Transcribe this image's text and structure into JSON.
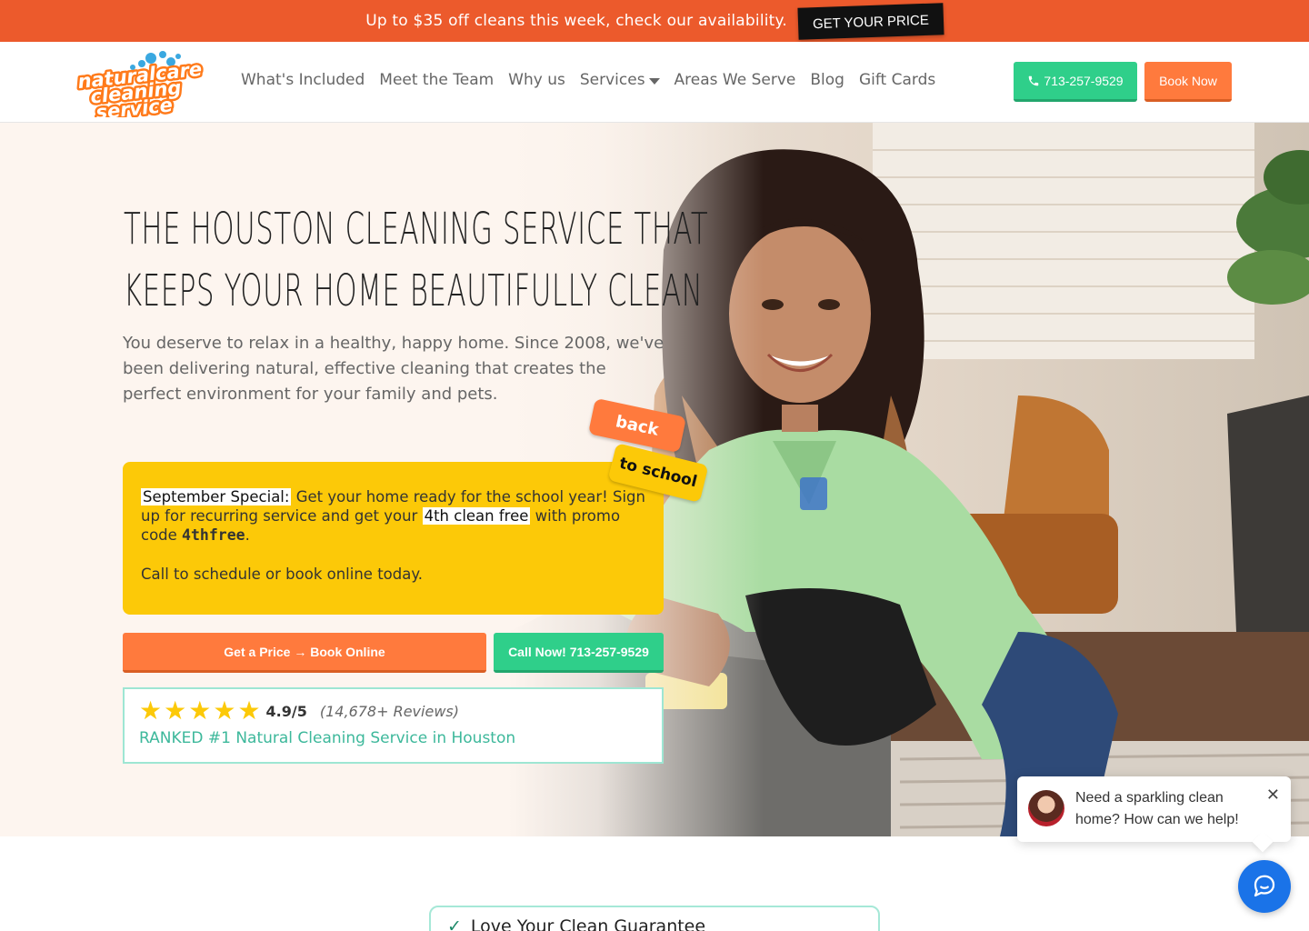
{
  "promo": {
    "text": "Up to $35 off cleans this week, check our availability.",
    "button": "GET YOUR PRICE"
  },
  "header": {
    "logo": [
      "naturalcare",
      "cleaning",
      "service"
    ],
    "nav": [
      "What's Included",
      "Meet the Team",
      "Why us",
      "Services",
      "Areas We Serve",
      "Blog",
      "Gift Cards"
    ],
    "phone": "713-257-9529",
    "book": "Book Now"
  },
  "hero": {
    "title_line1": "The Houston Cleaning Service That",
    "title_line2": "Keeps Your Home Beautifully Clean",
    "subtitle": "You deserve to relax in a healthy, happy home. Since 2008, we've been delivering natural, effective cleaning that creates the perfect environment for your family and pets.",
    "sticker_top": "back",
    "sticker_bottom": "to school",
    "special": {
      "label": "September Special:",
      "text1": " Get your home ready for the school year! Sign up for recurring service and get your ",
      "highlight": "4th clean free",
      "text2": " with promo code ",
      "code": "4thfree",
      "text3": ".",
      "cta": "Call to schedule or book online today."
    },
    "cta_price": "Get a Price → Book Online",
    "cta_call": "Call Now! 713-257-9529",
    "reviews": {
      "stars": 5,
      "rating": "4.9/5",
      "count": "(14,678+ Reviews)",
      "ranked": "RANKED #1 Natural Cleaning Service in Houston"
    }
  },
  "guarantee": {
    "title": "Love Your Clean Guarantee"
  },
  "chat": {
    "message": "Need a sparkling clean home? How can we help!"
  },
  "colors": {
    "orange": "#ec5a2c",
    "green": "#2fcf8a",
    "yellow": "#fcc908",
    "teal": "#3db89b"
  }
}
